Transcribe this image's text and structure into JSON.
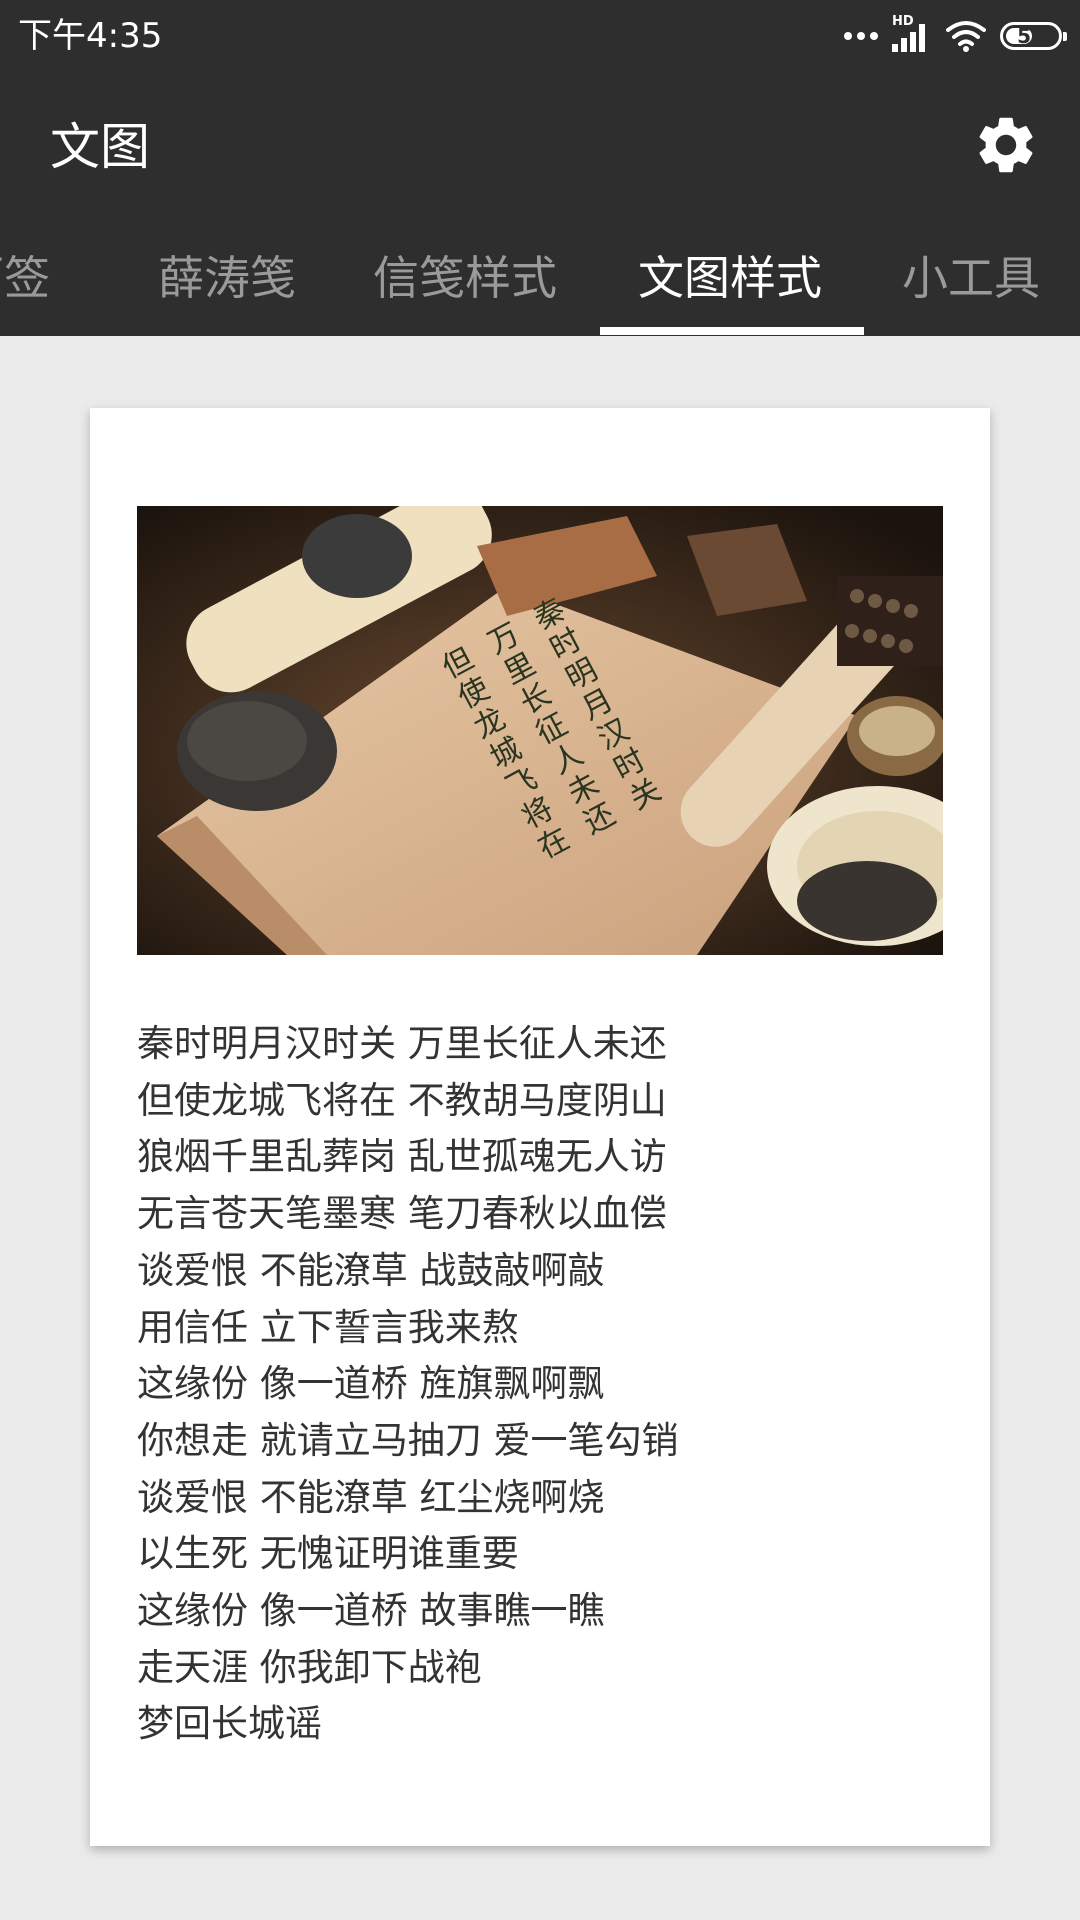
{
  "status_bar": {
    "time": "下午4:35",
    "network_badge": "HD",
    "battery_level": "57"
  },
  "app_bar": {
    "title": "文图",
    "settings_icon": "gear-icon"
  },
  "tabs": [
    {
      "label": "历签"
    },
    {
      "label": "薛涛笺"
    },
    {
      "label": "信笺样式"
    },
    {
      "label": "文图样式",
      "active": true
    },
    {
      "label": "小工具"
    }
  ],
  "card": {
    "image": {
      "calligraphy_lines": [
        "秦时明月汉时关",
        "万里长征人未还",
        "但使龙城飞将在"
      ]
    },
    "poem_lines": [
      "秦时明月汉时关 万里长征人未还",
      "但使龙城飞将在 不教胡马度阴山",
      "狼烟千里乱葬岗 乱世孤魂无人访",
      "无言苍天笔墨寒 笔刀春秋以血偿",
      "谈爱恨 不能潦草 战鼓敲啊敲",
      "用信任 立下誓言我来熬",
      "这缘份 像一道桥 旌旗飘啊飘",
      "你想走 就请立马抽刀 爱一笔勾销",
      "谈爱恨 不能潦草 红尘烧啊烧",
      "以生死 无愧证明谁重要",
      "这缘份 像一道桥 故事瞧一瞧",
      "走天涯 你我卸下战袍",
      "梦回长城谣"
    ]
  },
  "colors": {
    "app_bar": "#2e2e2e",
    "background": "#ebebeb",
    "tab_inactive": "#9a9a9a",
    "tab_active": "#ffffff",
    "poem_text": "#333333"
  }
}
